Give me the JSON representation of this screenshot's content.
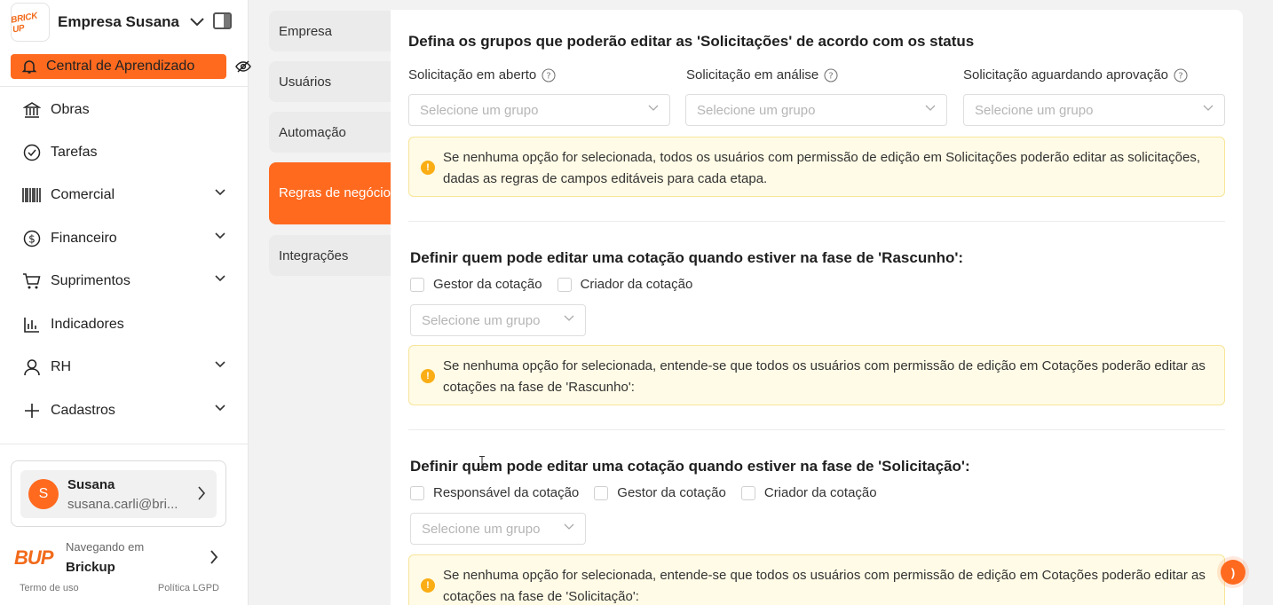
{
  "sidebar": {
    "company_logo_text": "BRICK UP",
    "company_name": "Empresa Susana",
    "learning_button": "Central de Aprendizado",
    "nav_items": [
      {
        "label": "Obras",
        "icon": "bank-icon",
        "has_chevron": false
      },
      {
        "label": "Tarefas",
        "icon": "check-circle-icon",
        "has_chevron": false
      },
      {
        "label": "Comercial",
        "icon": "barcode-icon",
        "has_chevron": true
      },
      {
        "label": "Financeiro",
        "icon": "dollar-circle-icon",
        "has_chevron": true
      },
      {
        "label": "Suprimentos",
        "icon": "cart-icon",
        "has_chevron": true
      },
      {
        "label": "Indicadores",
        "icon": "bar-chart-icon",
        "has_chevron": false
      },
      {
        "label": "RH",
        "icon": "user-icon",
        "has_chevron": true
      },
      {
        "label": "Cadastros",
        "icon": "plus-icon",
        "has_chevron": true
      }
    ],
    "user": {
      "initial": "S",
      "name": "Susana",
      "email": "susana.carli@bri..."
    },
    "brand": {
      "logo": "BUP",
      "navigating_label": "Navegando em",
      "name": "Brickup"
    },
    "footer": {
      "terms": "Termo de uso",
      "privacy": "Política LGPD"
    }
  },
  "settings_nav": {
    "items": [
      "Empresa",
      "Usuários",
      "Automação",
      "Regras de negócio",
      "Integrações"
    ],
    "active": "Regras de negócio"
  },
  "content": {
    "section1": {
      "title": "Defina os grupos que poderão editar as 'Solicitações' de acordo com os status",
      "fields": [
        {
          "label": "Solicitação em aberto",
          "placeholder": "Selecione um grupo"
        },
        {
          "label": "Solicitação em análise",
          "placeholder": "Selecione um grupo"
        },
        {
          "label": "Solicitação aguardando aprovação",
          "placeholder": "Selecione um grupo"
        }
      ],
      "alert": "Se nenhuma opção for selecionada, todos os usuários com permissão de edição em Solicitações poderão editar as solicitações, dadas as regras de campos editáveis para cada etapa."
    },
    "section2": {
      "title": "Definir quem pode editar uma cotação quando estiver na fase de 'Rascunho':",
      "checkboxes": [
        "Gestor da cotação",
        "Criador da cotação"
      ],
      "placeholder": "Selecione um grupo",
      "alert": "Se nenhuma opção for selecionada, entende-se que todos os usuários com permissão de edição em Cotações poderão editar as cotações na fase de 'Rascunho':"
    },
    "section3": {
      "title": "Definir quem pode editar uma cotação quando estiver na fase de 'Solicitação':",
      "checkboxes": [
        "Responsável da cotação",
        "Gestor da cotação",
        "Criador da cotação"
      ],
      "placeholder": "Selecione um grupo",
      "alert": "Se nenhuma opção for selecionada, entende-se que todos os usuários com permissão de edição em Cotações poderão editar as cotações na fase de 'Solicitação':"
    }
  },
  "colors": {
    "accent": "#ff6a1f",
    "alert_bg": "#fffbe6",
    "alert_border": "#f7e59a",
    "warning_icon": "#faad14"
  }
}
